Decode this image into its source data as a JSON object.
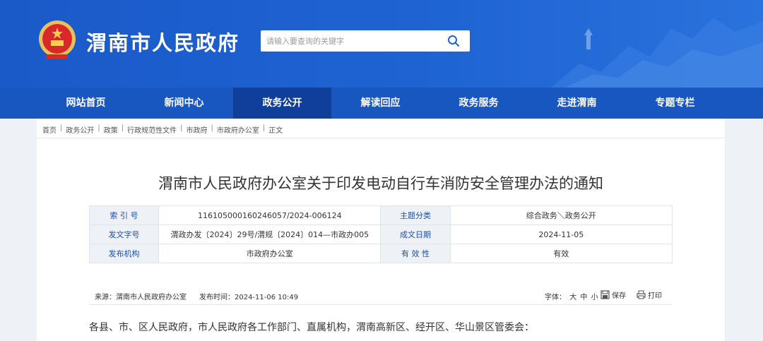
{
  "header": {
    "site_title": "渭南市人民政府",
    "search_placeholder": "请输入要查询的关键字"
  },
  "nav": {
    "items": [
      {
        "label": "网站首页"
      },
      {
        "label": "新闻中心"
      },
      {
        "label": "政务公开",
        "active": true
      },
      {
        "label": "解读回应"
      },
      {
        "label": "政务服务"
      },
      {
        "label": "走进渭南"
      },
      {
        "label": "专题专栏"
      }
    ]
  },
  "breadcrumb": [
    "首页",
    "政务公开",
    "政策",
    "行政规范性文件",
    "市政府",
    "市政府办公室",
    "正文"
  ],
  "article": {
    "title": "渭南市人民政府办公室关于印发电动自行车消防安全管理办法的通知",
    "meta": {
      "index_label": "索 引 号",
      "index_value": "116105000160246057/2024-006124",
      "category_label": "主题分类",
      "category_value": "综合政务＼政务公开",
      "doc_no_label": "发文字号",
      "doc_no_value": "渭政办发〔2024〕29号/渭规〔2024〕014—市政办005",
      "date_label": "成文日期",
      "date_value": "2024-11-05",
      "issuer_label": "发布机构",
      "issuer_value": "市政府办公室",
      "validity_label": "有 效 性",
      "validity_value": "有效"
    },
    "source": "来源：渭南市人民政府办公室",
    "publish_time": "发布时间：2024-11-06 10:49",
    "font_size_label": "字体：",
    "font_big": "大",
    "font_mid": "中",
    "font_small": "小",
    "save_label": "保存",
    "print_label": "打印",
    "salutation": "各县、市、区人民政府，市人民政府各工作部门、直属机构，渭南高新区、经开区、华山景区管委会："
  },
  "colors": {
    "header_blue": "#1f63d3",
    "nav_blue": "#1856c0",
    "nav_active": "#0f3f9a",
    "label_blue": "#1a4fb0"
  }
}
